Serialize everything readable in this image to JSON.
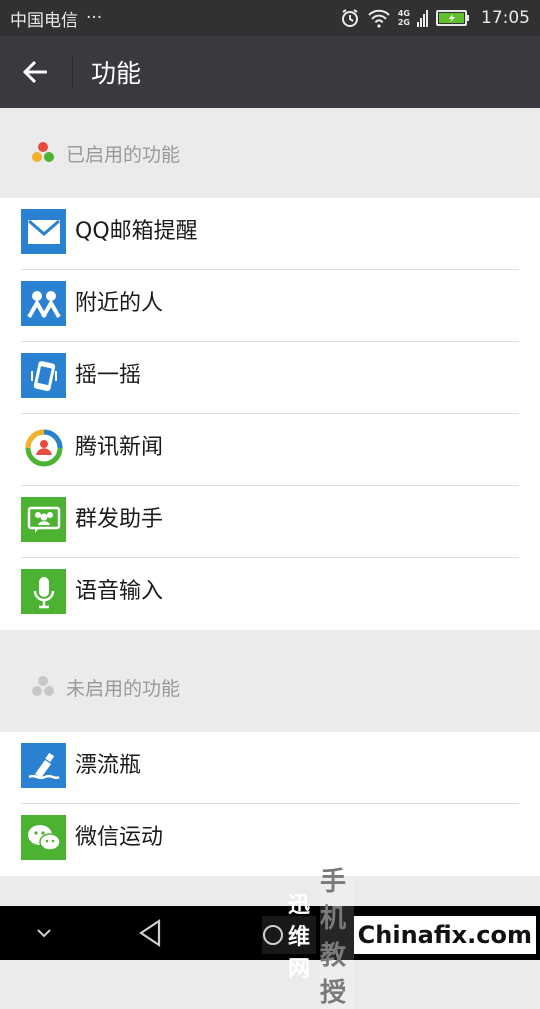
{
  "status_bar": {
    "carrier": "中国电信",
    "dots": "···",
    "net_top": "4G",
    "net_bottom": "2G",
    "time": "17:05"
  },
  "action_bar": {
    "title": "功能"
  },
  "enabled_section": {
    "label": "已启用的功能",
    "items": [
      {
        "label": "QQ邮箱提醒",
        "icon": "mail-icon",
        "color": "#2b81d1"
      },
      {
        "label": "附近的人",
        "icon": "people-nearby-icon",
        "color": "#2b81d1"
      },
      {
        "label": "摇一摇",
        "icon": "shake-icon",
        "color": "#2b81d1"
      },
      {
        "label": "腾讯新闻",
        "icon": "tencent-news-icon",
        "color": "#ffffff"
      },
      {
        "label": "群发助手",
        "icon": "mass-send-icon",
        "color": "#4cb232"
      },
      {
        "label": "语音输入",
        "icon": "microphone-icon",
        "color": "#4cb232"
      }
    ]
  },
  "disabled_section": {
    "label": "未启用的功能",
    "items": [
      {
        "label": "漂流瓶",
        "icon": "drift-bottle-icon",
        "color": "#2b81d1"
      },
      {
        "label": "微信运动",
        "icon": "wechat-sport-icon",
        "color": "#4cb232"
      }
    ]
  },
  "watermark": {
    "left": "迅维网",
    "mid": "手机教授",
    "right": "Chinafix.com"
  },
  "colors": {
    "status_bar_bg": "#2f3133",
    "action_bar_bg": "#393a3f",
    "page_bg": "#ebebeb",
    "blue": "#2b81d1",
    "green": "#4cb232"
  }
}
